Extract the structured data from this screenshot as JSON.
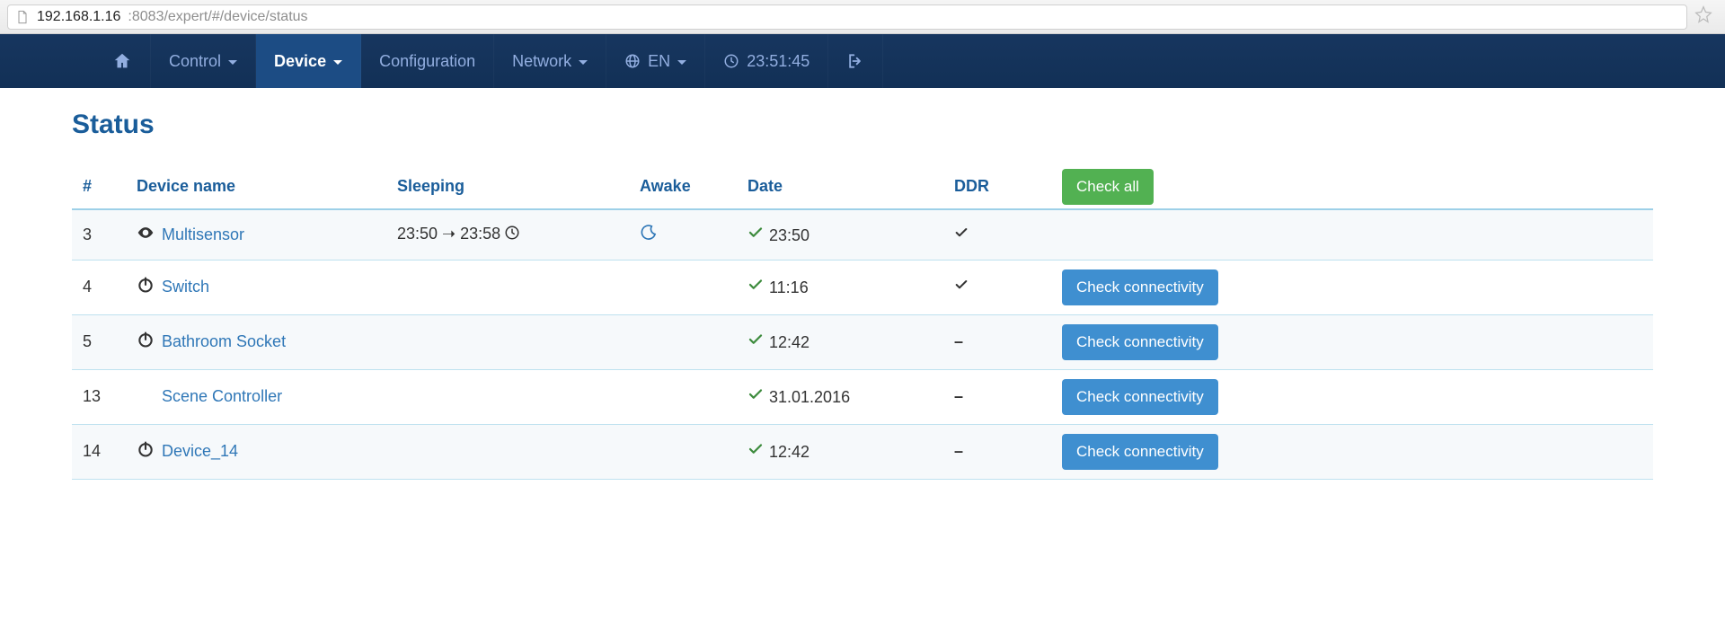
{
  "browser": {
    "url_host": "192.168.1.16",
    "url_rest": ":8083/expert/#/device/status"
  },
  "nav": {
    "home": "",
    "control": "Control",
    "device": "Device",
    "configuration": "Configuration",
    "network": "Network",
    "lang": "EN",
    "time": "23:51:45"
  },
  "page": {
    "title": "Status"
  },
  "table": {
    "headers": {
      "id": "#",
      "name": "Device name",
      "sleeping": "Sleeping",
      "awake": "Awake",
      "date": "Date",
      "ddr": "DDR"
    },
    "check_all": "Check all",
    "check_connectivity": "Check connectivity",
    "rows": [
      {
        "id": "3",
        "icon": "eye",
        "name": "Multisensor",
        "sleeping": "23:50 ➝ 23:58",
        "sleep_clock": true,
        "awake_moon": true,
        "date": "23:50",
        "ddr": "check",
        "action": null
      },
      {
        "id": "4",
        "icon": "power",
        "name": "Switch",
        "sleeping": "",
        "sleep_clock": false,
        "awake_moon": false,
        "date": "11:16",
        "ddr": "check",
        "action": "check"
      },
      {
        "id": "5",
        "icon": "power",
        "name": "Bathroom Socket",
        "sleeping": "",
        "sleep_clock": false,
        "awake_moon": false,
        "date": "12:42",
        "ddr": "dash",
        "action": "check"
      },
      {
        "id": "13",
        "icon": "none",
        "name": "Scene Controller",
        "sleeping": "",
        "sleep_clock": false,
        "awake_moon": false,
        "date": "31.01.2016",
        "ddr": "dash",
        "action": "check"
      },
      {
        "id": "14",
        "icon": "power",
        "name": "Device_14",
        "sleeping": "",
        "sleep_clock": false,
        "awake_moon": false,
        "date": "12:42",
        "ddr": "dash",
        "action": "check"
      }
    ]
  }
}
